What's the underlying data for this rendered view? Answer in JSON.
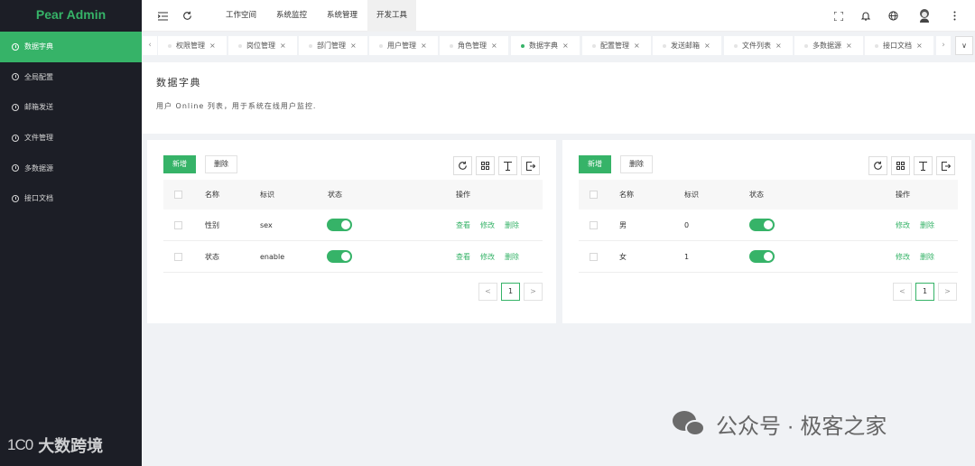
{
  "sidebar": {
    "logo": "Pear Admin",
    "items": [
      {
        "label": "数据字典"
      },
      {
        "label": "全局配置"
      },
      {
        "label": "邮箱发送"
      },
      {
        "label": "文件管理"
      },
      {
        "label": "多数据源"
      },
      {
        "label": "接口文档"
      }
    ],
    "brand_mark": "1C0",
    "brand_text": "大数跨境"
  },
  "header": {
    "tabs": [
      "工作空间",
      "系统监控",
      "系统管理",
      "开发工具"
    ],
    "active_tab": "开发工具",
    "icons": [
      "menu-fold-icon",
      "refresh-icon",
      "fullscreen-icon",
      "bell-icon",
      "globe-icon",
      "avatar",
      "more-icon"
    ]
  },
  "tabbar": {
    "tabs": [
      {
        "label": "权限管理"
      },
      {
        "label": "岗位管理"
      },
      {
        "label": "部门管理"
      },
      {
        "label": "用户管理"
      },
      {
        "label": "角色管理"
      },
      {
        "label": "数据字典"
      },
      {
        "label": "配置管理"
      },
      {
        "label": "发送邮箱"
      },
      {
        "label": "文件列表"
      },
      {
        "label": "多数据源"
      },
      {
        "label": "接口文档"
      }
    ],
    "active": "数据字典",
    "close": "×",
    "prev": "‹",
    "next": "›",
    "menu": "∨"
  },
  "intro": {
    "title": "数据字典",
    "description": "用户 Online 列表，用于系统在线用户监控."
  },
  "left_table": {
    "add": "新增",
    "delete": "删除",
    "columns": [
      "名称",
      "标识",
      "状态",
      "操作"
    ],
    "rows": [
      {
        "name": "性别",
        "key": "sex",
        "enabled": true
      },
      {
        "name": "状态",
        "key": "enable",
        "enabled": true
      }
    ],
    "actions": [
      "查看",
      "修改",
      "删除"
    ],
    "page": "1",
    "prev": "<",
    "next": ">"
  },
  "right_table": {
    "add": "新增",
    "delete": "删除",
    "columns": [
      "名称",
      "标识",
      "状态",
      "操作"
    ],
    "rows": [
      {
        "name": "男",
        "key": "0",
        "enabled": true
      },
      {
        "name": "女",
        "key": "1",
        "enabled": true
      }
    ],
    "actions": [
      "修改",
      "删除"
    ],
    "page": "1",
    "prev": "<",
    "next": ">"
  },
  "watermark": "公众号 · 极客之家",
  "colors": {
    "accent": "#36b368",
    "sidebar_bg": "#1c1e26",
    "page_bg": "#f0f2f5"
  }
}
